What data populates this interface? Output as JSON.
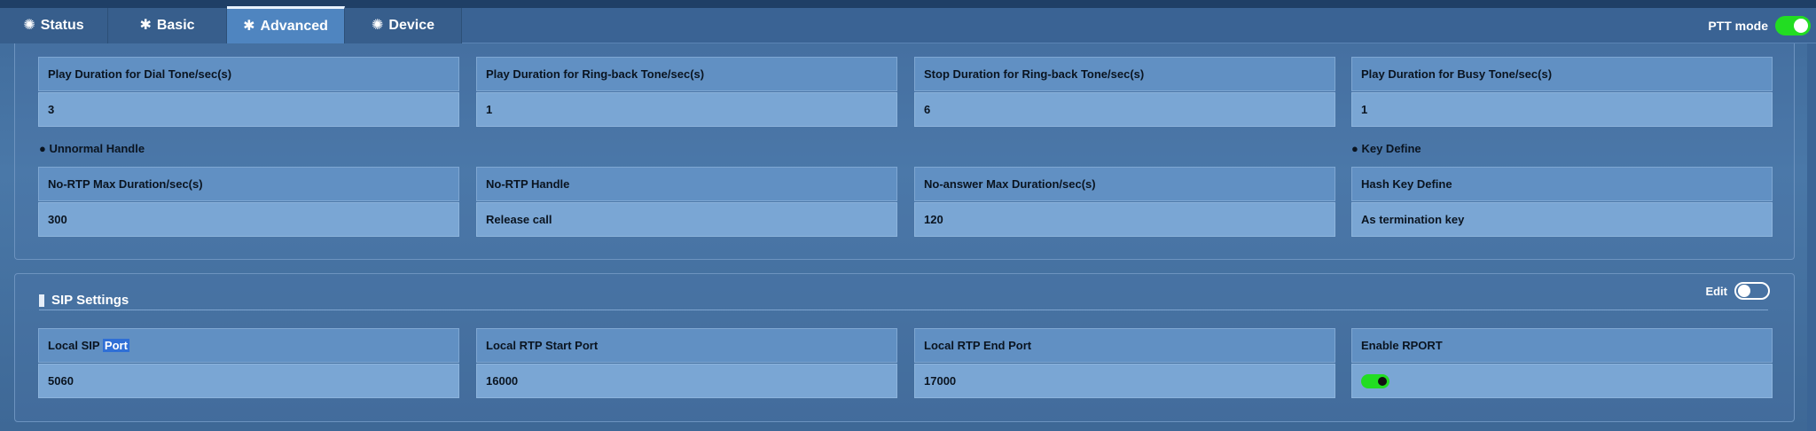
{
  "tabs": [
    {
      "icon": "gear-icon",
      "label": "Status"
    },
    {
      "icon": "asterisk-icon",
      "label": "Basic"
    },
    {
      "icon": "asterisk-icon",
      "label": "Advanced"
    },
    {
      "icon": "gear-icon",
      "label": "Device"
    }
  ],
  "active_tab": "Advanced",
  "ptt": {
    "label": "PTT mode",
    "enabled": true
  },
  "tone_settings": [
    {
      "label": "Play Duration for Dial Tone/sec(s)",
      "value": "3"
    },
    {
      "label": "Play Duration for Ring-back Tone/sec(s)",
      "value": "1"
    },
    {
      "label": "Stop Duration for Ring-back Tone/sec(s)",
      "value": "6"
    },
    {
      "label": "Play Duration for Busy Tone/sec(s)",
      "value": "1"
    }
  ],
  "unnormal_handle": {
    "title": "Unnormal Handle",
    "fields": [
      {
        "label": "No-RTP Max Duration/sec(s)",
        "value": "300"
      },
      {
        "label": "No-RTP Handle",
        "value": "Release call"
      },
      {
        "label": "No-answer Max Duration/sec(s)",
        "value": "120"
      }
    ]
  },
  "key_define": {
    "title": "Key Define",
    "fields": [
      {
        "label": "Hash Key Define",
        "value": "As termination key"
      }
    ]
  },
  "sip_settings": {
    "title": "SIP Settings",
    "edit_label": "Edit",
    "edit_enabled": false,
    "fields": [
      {
        "label_prefix": "Local SIP ",
        "label_highlight": "Port",
        "value": "5060"
      },
      {
        "label": "Local RTP Start Port",
        "value": "16000"
      },
      {
        "label": "Local RTP End Port",
        "value": "17000"
      },
      {
        "label": "Enable RPORT",
        "value_toggle": true
      }
    ]
  },
  "colors": {
    "toggle_on": "#22dd22",
    "highlight": "#2f6fd6"
  }
}
